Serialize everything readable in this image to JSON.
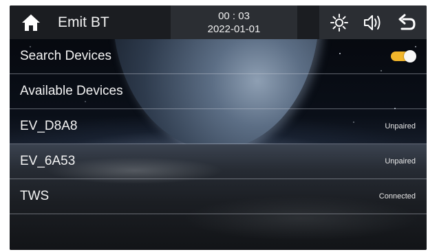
{
  "header": {
    "title": "Emit BT",
    "time": "00 : 03",
    "date": "2022-01-01",
    "icons": [
      "home-icon",
      "brightness-icon",
      "volume-icon",
      "back-icon"
    ]
  },
  "search": {
    "label": "Search Devices",
    "toggle_on": true
  },
  "available_label": "Available Devices",
  "devices": [
    {
      "name": "EV_D8A8",
      "status": "Unpaired"
    },
    {
      "name": "EV_6A53",
      "status": "Unpaired"
    },
    {
      "name": "TWS",
      "status": "Connected"
    }
  ],
  "colors": {
    "accent_toggle": "#f2b62b",
    "topbar": "#1b1d21",
    "topbar_panel": "#2b2e33"
  }
}
